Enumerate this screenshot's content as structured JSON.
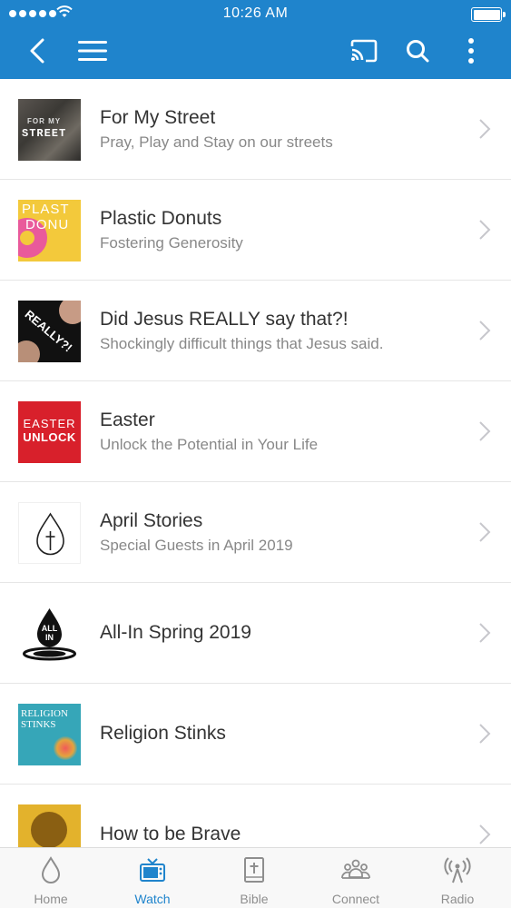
{
  "status_bar": {
    "time": "10:26 AM"
  },
  "colors": {
    "accent": "#1f84cc",
    "tab_inactive": "#8e8e8e"
  },
  "nav": {
    "icons": [
      "back-icon",
      "menu-icon",
      "cast-icon",
      "search-icon",
      "more-icon"
    ]
  },
  "series": [
    {
      "title": "For My Street",
      "subtitle": "Pray, Play and Stay on our streets",
      "thumb_text": [
        "FOR MY",
        "STREET"
      ]
    },
    {
      "title": "Plastic Donuts",
      "subtitle": "Fostering Generosity",
      "thumb_text": [
        "PLAST",
        "DONU"
      ]
    },
    {
      "title": "Did Jesus REALLY say that?!",
      "subtitle": "Shockingly difficult things that Jesus said.",
      "thumb_text": [
        "REALLY?!"
      ]
    },
    {
      "title": "Easter",
      "subtitle": "Unlock the Potential in Your Life",
      "thumb_text": [
        "EASTER",
        "UNLOCK"
      ]
    },
    {
      "title": "April Stories",
      "subtitle": "Special Guests in April 2019"
    },
    {
      "title": "All-In Spring 2019",
      "thumb_text": [
        "ALL",
        "IN"
      ]
    },
    {
      "title": "Religion Stinks",
      "thumb_text": [
        "RELIGION",
        "STINKS"
      ]
    },
    {
      "title": "How to be Brave"
    }
  ],
  "tabs": [
    {
      "label": "Home",
      "icon": "drop-icon",
      "active": false
    },
    {
      "label": "Watch",
      "icon": "tv-icon",
      "active": true
    },
    {
      "label": "Bible",
      "icon": "bible-icon",
      "active": false
    },
    {
      "label": "Connect",
      "icon": "people-icon",
      "active": false
    },
    {
      "label": "Radio",
      "icon": "radio-icon",
      "active": false
    }
  ]
}
